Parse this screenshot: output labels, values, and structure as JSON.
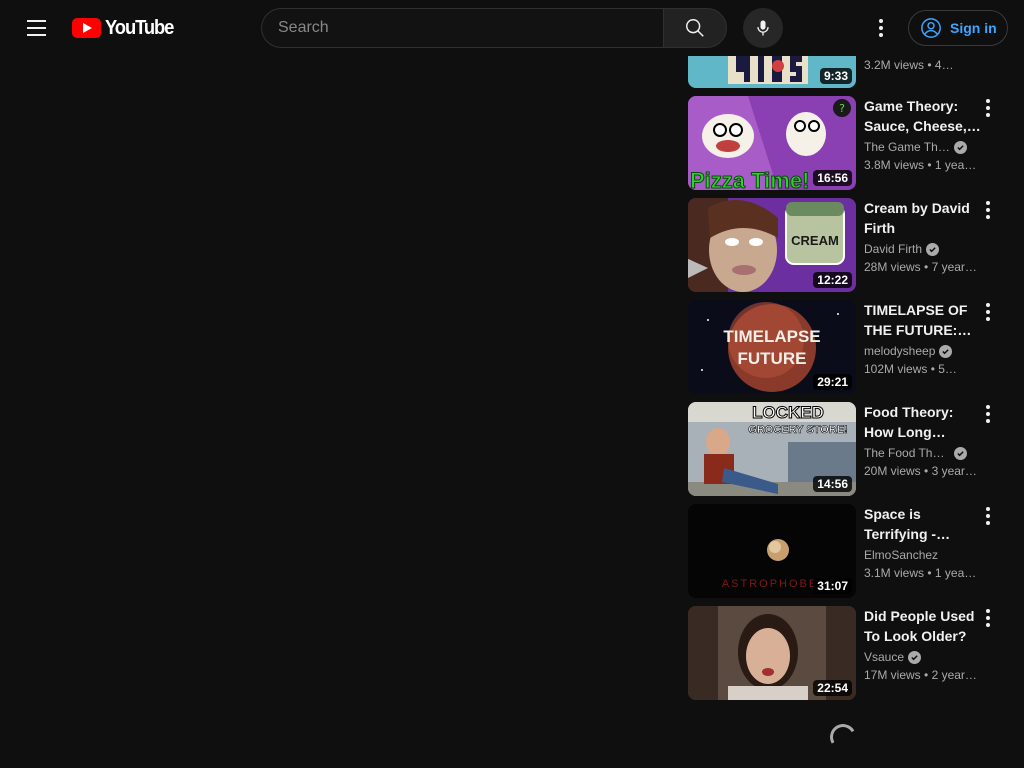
{
  "header": {
    "logo_text": "YouTube",
    "search_placeholder": "Search",
    "signin_label": "Sign in"
  },
  "videos": [
    {
      "title": "",
      "channel": "",
      "verified": false,
      "views": "3.2M views",
      "age": "4…",
      "duration": "9:33",
      "thumb_colors": [
        "#2a6e5a",
        "#5fb7c7"
      ]
    },
    {
      "title": "Game Theory: Sauce, Cheese,…",
      "channel": "The Game The…",
      "verified": true,
      "views": "3.8M views",
      "age": "1 yea…",
      "duration": "16:56",
      "thumb_colors": [
        "#8a3fb3",
        "#2fd12f"
      ]
    },
    {
      "title": "Cream by David Firth",
      "channel": "David Firth",
      "verified": true,
      "views": "28M views",
      "age": "7 year…",
      "duration": "12:22",
      "thumb_colors": [
        "#6b2fa0",
        "#c9b8a8"
      ]
    },
    {
      "title": "TIMELAPSE OF THE FUTURE: A…",
      "channel": "melodysheep",
      "verified": true,
      "views": "102M views",
      "age": "5…",
      "duration": "29:21",
      "thumb_colors": [
        "#0a0c1a",
        "#b0503a"
      ]
    },
    {
      "title": "Food Theory: How Long Could…",
      "channel": "The Food The…",
      "verified": true,
      "views": "20M views",
      "age": "3 year…",
      "duration": "14:56",
      "thumb_colors": [
        "#8a4a3a",
        "#5a6f8a"
      ]
    },
    {
      "title": "Space is Terrifying -…",
      "channel": "ElmoSanchez",
      "verified": false,
      "views": "3.1M views",
      "age": "1 yea…",
      "duration": "31:07",
      "thumb_colors": [
        "#050505",
        "#c8a070"
      ]
    },
    {
      "title": "Did People Used To Look Older?",
      "channel": "Vsauce",
      "verified": true,
      "views": "17M views",
      "age": "2 year…",
      "duration": "22:54",
      "thumb_colors": [
        "#3a2a24",
        "#b08a70"
      ]
    }
  ],
  "thumb_texts": {
    "pizza": "Pizza Time!",
    "cream": "CREAM",
    "timelapse": "TIMELAPSE",
    "future": "FUTURE",
    "locked": "LOCKED",
    "grocery": "GROCERY STORE!",
    "astrophobe": "ASTROPHOBE"
  }
}
